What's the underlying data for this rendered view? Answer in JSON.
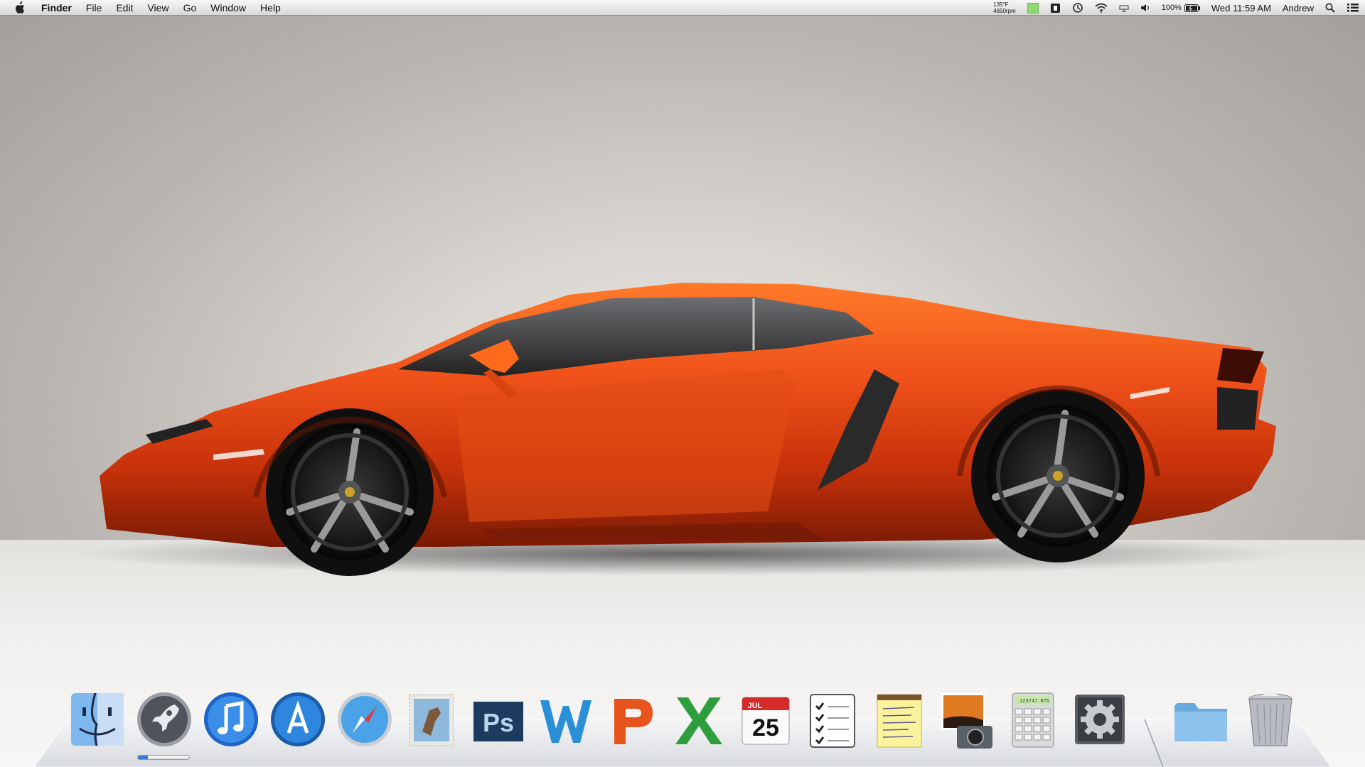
{
  "menubar": {
    "app_name": "Finder",
    "menus": [
      "File",
      "Edit",
      "View",
      "Go",
      "Window",
      "Help"
    ],
    "status": {
      "temperature": "135°F",
      "fan_speed": "4650rpm",
      "battery": "100%",
      "clock": "Wed 11:59 AM",
      "user": "Andrew"
    }
  },
  "calendar_icon": {
    "month": "JUL",
    "day": "25"
  },
  "calculator_display": "123747.875",
  "dock": {
    "items": [
      {
        "name": "Finder",
        "icon": "finder-icon"
      },
      {
        "name": "Launchpad",
        "icon": "rocket-icon"
      },
      {
        "name": "iTunes",
        "icon": "music-note-icon"
      },
      {
        "name": "App Store",
        "icon": "app-store-icon"
      },
      {
        "name": "Safari",
        "icon": "compass-icon"
      },
      {
        "name": "Mail",
        "icon": "stamp-icon"
      },
      {
        "name": "Photoshop",
        "icon": "ps-icon"
      },
      {
        "name": "Word",
        "icon": "w-icon"
      },
      {
        "name": "PowerPoint",
        "icon": "p-icon"
      },
      {
        "name": "Excel",
        "icon": "x-icon"
      },
      {
        "name": "iCal",
        "icon": "calendar-icon"
      },
      {
        "name": "Reminders",
        "icon": "checklist-icon"
      },
      {
        "name": "Notes",
        "icon": "notepad-icon"
      },
      {
        "name": "iPhoto",
        "icon": "photo-camera-icon"
      },
      {
        "name": "Calculator",
        "icon": "calculator-icon"
      },
      {
        "name": "System Preferences",
        "icon": "gear-icon"
      },
      {
        "name": "Documents",
        "icon": "folder-icon"
      },
      {
        "name": "Trash",
        "icon": "trash-icon"
      }
    ],
    "launch_progress": 0.2
  },
  "colors": {
    "car_body": "#e84a10",
    "menubar_bg": "#e8e8e8",
    "wallpaper": "#c9c6c2"
  }
}
